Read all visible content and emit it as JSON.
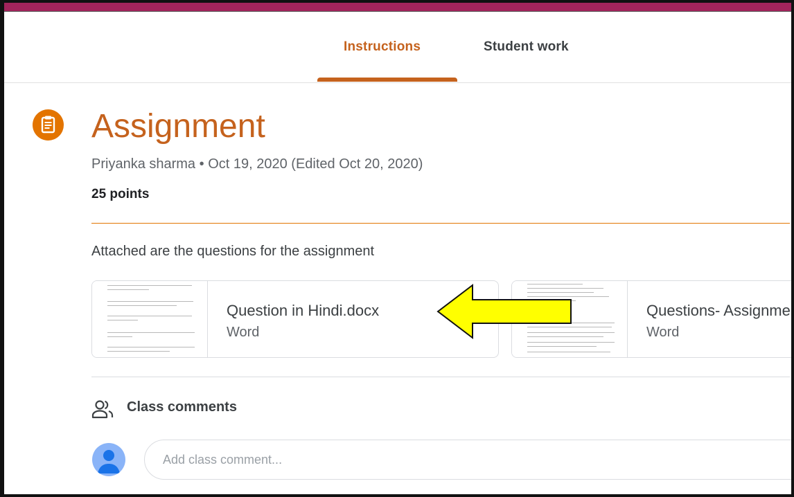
{
  "tabs": [
    {
      "label": "Instructions",
      "active": true
    },
    {
      "label": "Student work",
      "active": false
    }
  ],
  "assignment": {
    "icon": "assignment-clipboard-icon",
    "title": "Assignment",
    "author": "Priyanka sharma",
    "separator": "•",
    "posted": "Oct 19, 2020 (Edited Oct 20, 2020)",
    "points": "25 points",
    "description": "Attached are the questions for the assignment"
  },
  "attachments": [
    {
      "title": "Question in Hindi.docx",
      "type": "Word"
    },
    {
      "title": "Questions- Assignment",
      "type": "Word"
    }
  ],
  "comments": {
    "icon": "people-icon",
    "label": "Class comments",
    "placeholder": "Add class comment..."
  },
  "colors": {
    "accent": "#c5621d",
    "icon_bg": "#e37400",
    "topbar": "#a3245c",
    "arrow_fill": "#ffff00"
  }
}
